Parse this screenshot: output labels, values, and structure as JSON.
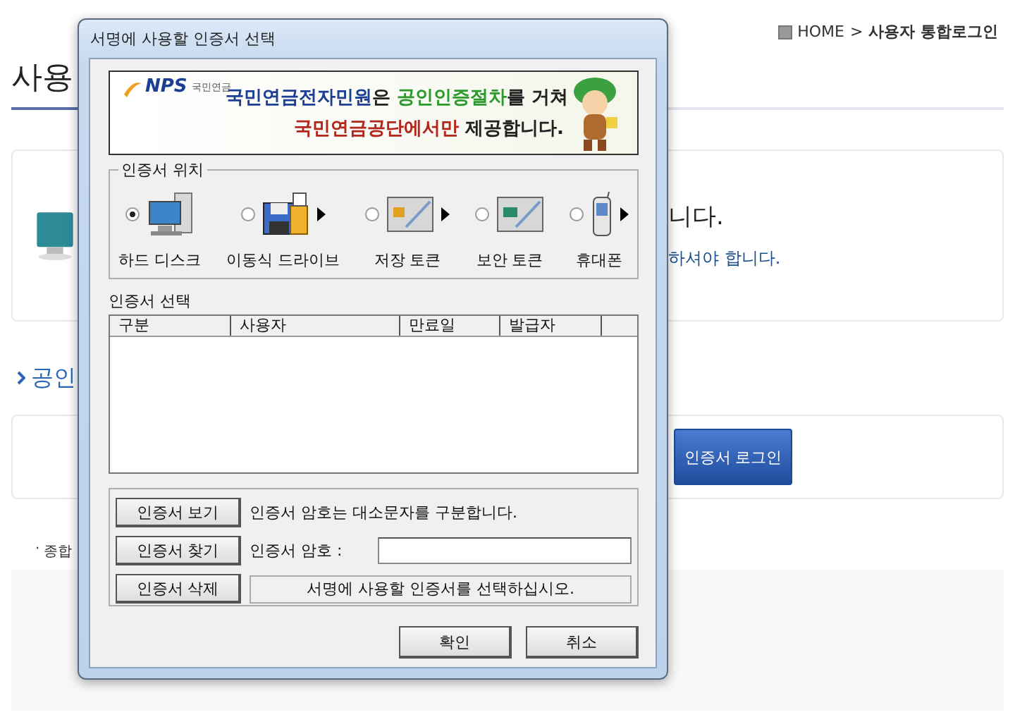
{
  "page": {
    "breadcrumb": {
      "home": "HOME",
      "separator": ">",
      "current": "사용자 통합로그인"
    },
    "title": "사용",
    "notice": {
      "heading": "니다.",
      "detail": "하셔야 합니다."
    },
    "section_heading": "공인",
    "login_button": "인증서 로그인",
    "footnote_bullet": "·",
    "footnote": "종합"
  },
  "dialog": {
    "title": "서명에 사용할 인증서 선택",
    "banner": {
      "logo": "NPS",
      "logo_caption": "국민연금",
      "lines": [
        [
          {
            "text": "국민연금전자민원",
            "color": "#1c3f94"
          },
          {
            "text": "은 ",
            "color": "#222222"
          },
          {
            "text": "공인인증절차",
            "color": "#2b9a2b"
          },
          {
            "text": "를 거쳐",
            "color": "#222222"
          }
        ],
        [
          {
            "text": "국민연금공단에서만",
            "color": "#b2261c"
          },
          {
            "text": " 제공합니다.",
            "color": "#222222"
          }
        ]
      ]
    },
    "location": {
      "label": "인증서 위치",
      "options": [
        {
          "kind": "disk",
          "label": "하드 디스크",
          "selected": true,
          "arrow": false
        },
        {
          "kind": "drive",
          "label": "이동식 드라이브",
          "selected": false,
          "arrow": true
        },
        {
          "kind": "token",
          "label": "저장 토큰",
          "selected": false,
          "arrow": true
        },
        {
          "kind": "hsm",
          "label": "보안 토큰",
          "selected": false,
          "arrow": false
        },
        {
          "kind": "phone",
          "label": "휴대폰",
          "selected": false,
          "arrow": true
        }
      ]
    },
    "list": {
      "label": "인증서 선택",
      "columns": [
        "구분",
        "사용자",
        "만료일",
        "발급자"
      ]
    },
    "actions": [
      {
        "label": "인증서 보기",
        "kind": "text",
        "text": "인증서 암호는 대소문자를 구분합니다."
      },
      {
        "label": "인증서 찾기",
        "kind": "field",
        "text": "인증서 암호 :"
      },
      {
        "label": "인증서 삭제",
        "kind": "status",
        "text": "서명에 사용할 인증서를 선택하십시오."
      }
    ],
    "buttons": [
      "확인",
      "취소"
    ]
  }
}
